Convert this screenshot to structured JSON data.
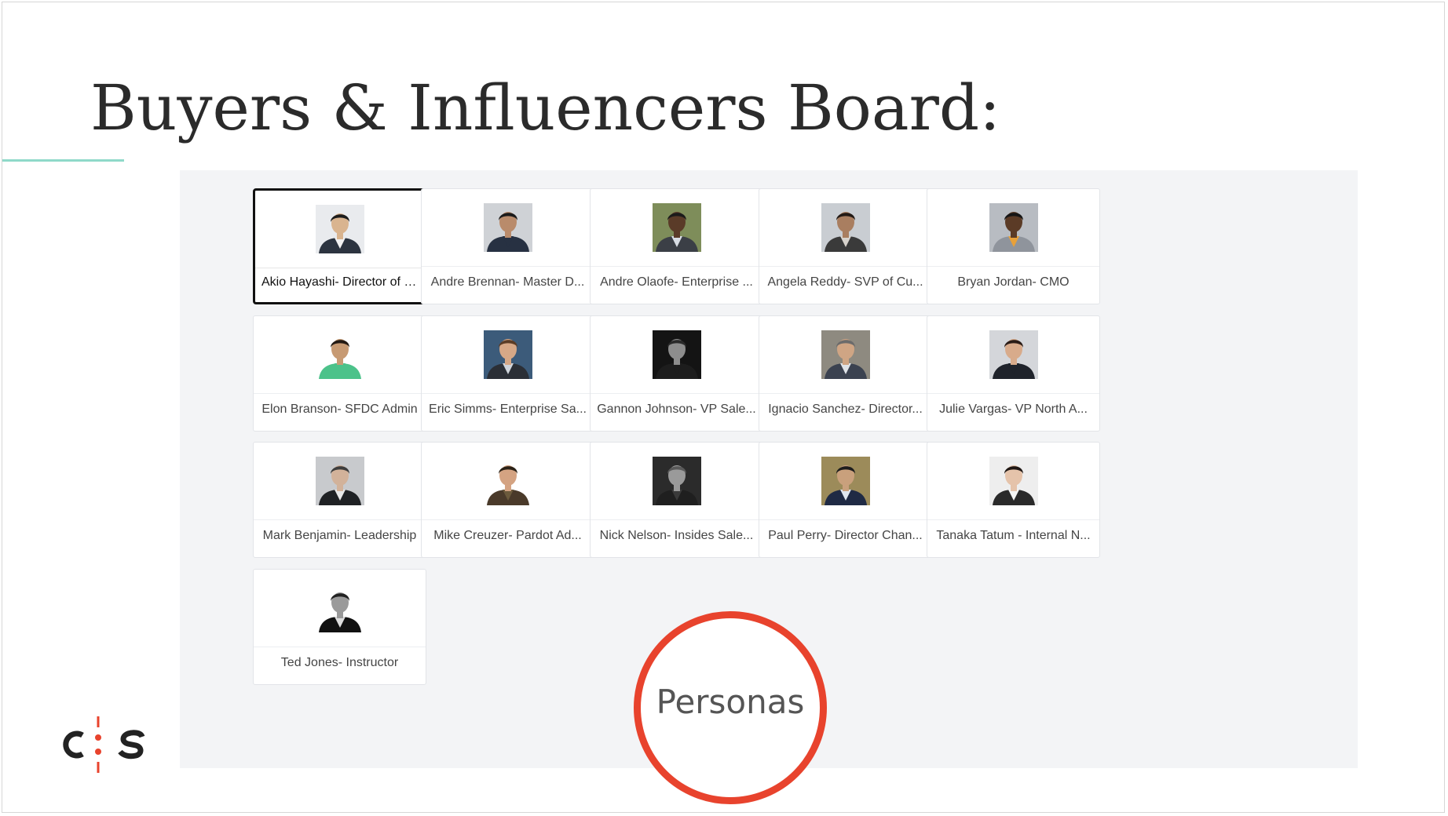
{
  "slide": {
    "title": "Buyers & Influencers Board:",
    "accent_color": "#8fd9c9"
  },
  "board": {
    "cards": [
      {
        "label": "Akio Hayashi- Director of I...",
        "selected": true,
        "photo": {
          "bg": "#e9ebee",
          "skin": "#d9b48f",
          "hair": "#1c1c1c",
          "suit": "#2c3440",
          "shirt": "#f2f2f2"
        }
      },
      {
        "label": "Andre Brennan- Master D...",
        "selected": false,
        "photo": {
          "bg": "#cfd2d6",
          "skin": "#b98b6b",
          "hair": "#1b1b1b",
          "suit": "#273142",
          "shirt": "#273142"
        }
      },
      {
        "label": "Andre Olaofe- Enterprise ...",
        "selected": false,
        "photo": {
          "bg": "#7e8d5a",
          "skin": "#5a3b28",
          "hair": "#1b1b1b",
          "suit": "#3b3f46",
          "shirt": "#d8dde4"
        }
      },
      {
        "label": "Angela Reddy- SVP of Cu...",
        "selected": false,
        "photo": {
          "bg": "#c9cdd2",
          "skin": "#a97e60",
          "hair": "#221a16",
          "suit": "#3a3a3a",
          "shirt": "#d7d2cc"
        }
      },
      {
        "label": "Bryan Jordan- CMO",
        "selected": false,
        "photo": {
          "bg": "#b8bcc2",
          "skin": "#5b3b26",
          "hair": "#161616",
          "suit": "#8f949c",
          "shirt": "#e8a13a"
        }
      },
      {
        "label": "Elon Branson- SFDC Admin",
        "selected": false,
        "photo": {
          "bg": "#ffffff",
          "skin": "#c79a73",
          "hair": "#231a14",
          "suit": "#4cc28a",
          "shirt": "#4cc28a"
        }
      },
      {
        "label": "Eric Simms- Enterprise Sa...",
        "selected": false,
        "photo": {
          "bg": "#3c5b7a",
          "skin": "#d6a887",
          "hair": "#5a3c26",
          "suit": "#2b2f36",
          "shirt": "#d0d5dc"
        }
      },
      {
        "label": "Gannon Johnson- VP Sale...",
        "selected": false,
        "photo": {
          "bg": "#141414",
          "skin": "#8d8d8d",
          "hair": "#2a2a2a",
          "suit": "#1d1d1d",
          "shirt": "#1d1d1d"
        }
      },
      {
        "label": "Ignacio Sanchez- Director...",
        "selected": false,
        "photo": {
          "bg": "#8e8a80",
          "skin": "#cfa584",
          "hair": "#6b6b6b",
          "suit": "#3b4250",
          "shirt": "#dfe3e8"
        }
      },
      {
        "label": "Julie Vargas- VP North A...",
        "selected": false,
        "photo": {
          "bg": "#d4d6da",
          "skin": "#d8ab8b",
          "hair": "#2a1c17",
          "suit": "#1f232b",
          "shirt": "#1f232b"
        }
      },
      {
        "label": "Mark Benjamin- Leadership",
        "selected": false,
        "photo": {
          "bg": "#c8cacd",
          "skin": "#d2b29a",
          "hair": "#3d3d3d",
          "suit": "#1f2124",
          "shirt": "#e8e8e8"
        }
      },
      {
        "label": "Mike Creuzer- Pardot Ad...",
        "selected": false,
        "photo": {
          "bg": "#ffffff",
          "skin": "#d4a382",
          "hair": "#2b2217",
          "suit": "#4a3a2a",
          "shirt": "#6b5a3c"
        }
      },
      {
        "label": "Nick Nelson- Insides Sale...",
        "selected": false,
        "photo": {
          "bg": "#2b2b2b",
          "skin": "#9a9a9a",
          "hair": "#5a5a5a",
          "suit": "#1f1f1f",
          "shirt": "#3a3a3a"
        }
      },
      {
        "label": "Paul Perry- Director Chan...",
        "selected": false,
        "photo": {
          "bg": "#9c8b5a",
          "skin": "#c9a07c",
          "hair": "#1d1d1d",
          "suit": "#1f2a44",
          "shirt": "#dfe6ef"
        }
      },
      {
        "label": "Tanaka Tatum - Internal N...",
        "selected": false,
        "photo": {
          "bg": "#eeeeee",
          "skin": "#e5c3aa",
          "hair": "#1f1714",
          "suit": "#2a2a2a",
          "shirt": "#f5f5f5"
        }
      },
      {
        "label": "Ted Jones- Instructor",
        "selected": false,
        "photo": {
          "bg": "#ffffff",
          "skin": "#9a9a9a",
          "hair": "#222222",
          "suit": "#111111",
          "shirt": "#dedede"
        }
      }
    ]
  },
  "annotation": {
    "label": "Personas",
    "ring_color": "#e8432d"
  },
  "logo": {
    "text": "C:S",
    "dot_color": "#e8432d"
  }
}
